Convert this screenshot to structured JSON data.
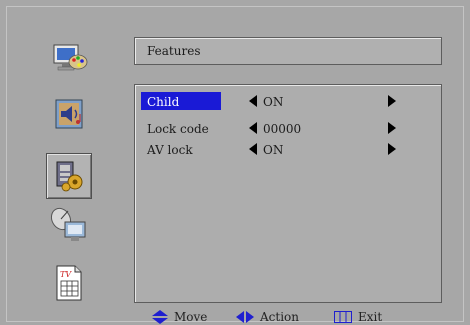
{
  "panel": {
    "title": "Features"
  },
  "sidebar": {
    "items": [
      {
        "icon": "desktop-paint-icon",
        "selected": false
      },
      {
        "icon": "speaker-music-icon",
        "selected": false
      },
      {
        "icon": "features-gear-icon",
        "selected": true
      },
      {
        "icon": "satellite-monitor-icon",
        "selected": false
      },
      {
        "icon": "tv-guide-icon",
        "label": "TV",
        "selected": false
      }
    ]
  },
  "settings": [
    {
      "label": "Child",
      "value": "ON",
      "active": true
    },
    {
      "label": "Lock code",
      "value": "00000",
      "active": false
    },
    {
      "label": "AV lock",
      "value": "ON",
      "active": false
    }
  ],
  "hints": {
    "move": "Move",
    "action": "Action",
    "exit": "Exit"
  },
  "colors": {
    "highlight": "#1a1ad6",
    "background": "#a9a9a9",
    "accent_blue": "#1f1fcf"
  }
}
